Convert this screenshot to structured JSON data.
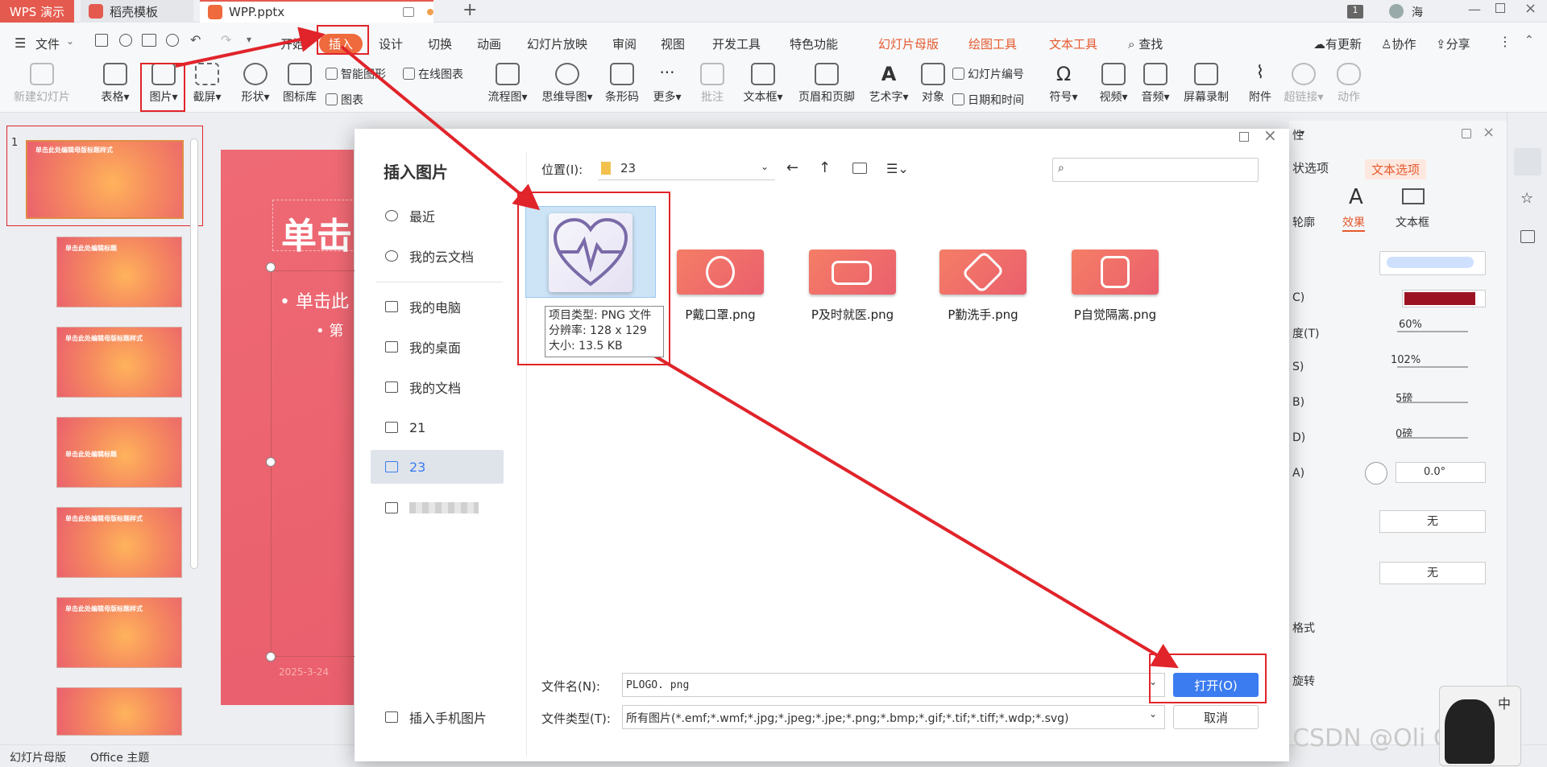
{
  "titlebar": {
    "app_tab": "WPS 演示",
    "template_tab": "稻壳模板",
    "doc_tab": "WPP.pptx",
    "user": "海",
    "badge": "1"
  },
  "menu": {
    "file": "文件",
    "items": [
      "开始",
      "插入",
      "设计",
      "切换",
      "动画",
      "幻灯片放映",
      "审阅",
      "视图",
      "开发工具",
      "特色功能",
      "幻灯片母版",
      "绘图工具",
      "文本工具"
    ],
    "search": "查找",
    "update": "有更新",
    "collab": "协作",
    "share": "分享"
  },
  "ribbon": {
    "new_slide": "新建幻灯片",
    "table": "表格",
    "picture": "图片",
    "screenshot": "截屏",
    "shape": "形状",
    "icons": "图标库",
    "smart": "智能图形",
    "online_chart": "在线图表",
    "chart": "图表",
    "flow": "流程图",
    "mind": "思维导图",
    "barcode": "条形码",
    "more": "更多",
    "comment": "批注",
    "textbox": "文本框",
    "header_footer": "页眉和页脚",
    "wordart": "艺术字",
    "object": "对象",
    "slide_no": "幻灯片编号",
    "datetime": "日期和时间",
    "symbol": "符号",
    "video": "视频",
    "audio": "音频",
    "record": "屏幕录制",
    "attach": "附件",
    "hyperlink": "超链接",
    "action": "动作"
  },
  "thumbs": {
    "first_no": "1",
    "titles": [
      "单击此处编辑母版标题样式",
      "单击此处编辑标题",
      "单击此处编辑母版标题样式",
      "单击此处编辑标题",
      "单击此处编辑母版标题样式",
      "单击此处编辑母版标题样式",
      ""
    ]
  },
  "slide": {
    "title": "单击",
    "bullet1": "单击此",
    "bullet2": "第",
    "date": "2025-3-24"
  },
  "rightpane": {
    "header": "性",
    "tab1": "状选项",
    "tab2": "文本选项",
    "sub1": "轮廓",
    "sub2": "效果",
    "sub3": "文本框",
    "r1": "C)",
    "r2": "度(T)",
    "v2": "60%",
    "r3": "S)",
    "v3": "102%",
    "r4": "B)",
    "v4": "5磅",
    "r5": "D)",
    "v5": "0磅",
    "r6": "A)",
    "v6": "0.0°",
    "none1": "无",
    "none2": "无",
    "r7": "格式",
    "r8": "旋转"
  },
  "dialog": {
    "title": "插入图片",
    "location_label": "位置(I):",
    "location": "23",
    "search_placeholder": "",
    "side": [
      "最近",
      "我的云文档",
      "我的电脑",
      "我的桌面",
      "我的文档",
      "21",
      "23",
      ""
    ],
    "phone": "插入手机图片",
    "files": [
      "P戴口罩.png",
      "P及时就医.png",
      "P勤洗手.png",
      "P自觉隔离.png"
    ],
    "tooltip": [
      "项目类型: PNG 文件",
      "分辨率: 128 x 129",
      "大小: 13.5 KB"
    ],
    "filename_label": "文件名(N):",
    "filename": "PLOGO. png",
    "filetype_label": "文件类型(T):",
    "filetype": "所有图片(*.emf;*.wmf;*.jpg;*.jpeg;*.jpe;*.png;*.bmp;*.gif;*.tif;*.tiff;*.wdp;*.svg)",
    "open": "打开(O)",
    "cancel": "取消"
  },
  "statusbar": {
    "mode": "幻灯片母版",
    "theme": "Office 主题"
  },
  "watermark": "CSDN @Oli Correct",
  "ime": "中",
  "colors": {
    "accent": "#ef6a3c",
    "red": "#e0242a",
    "blue": "#3b7cf0",
    "dark_red": "#9b1322"
  }
}
